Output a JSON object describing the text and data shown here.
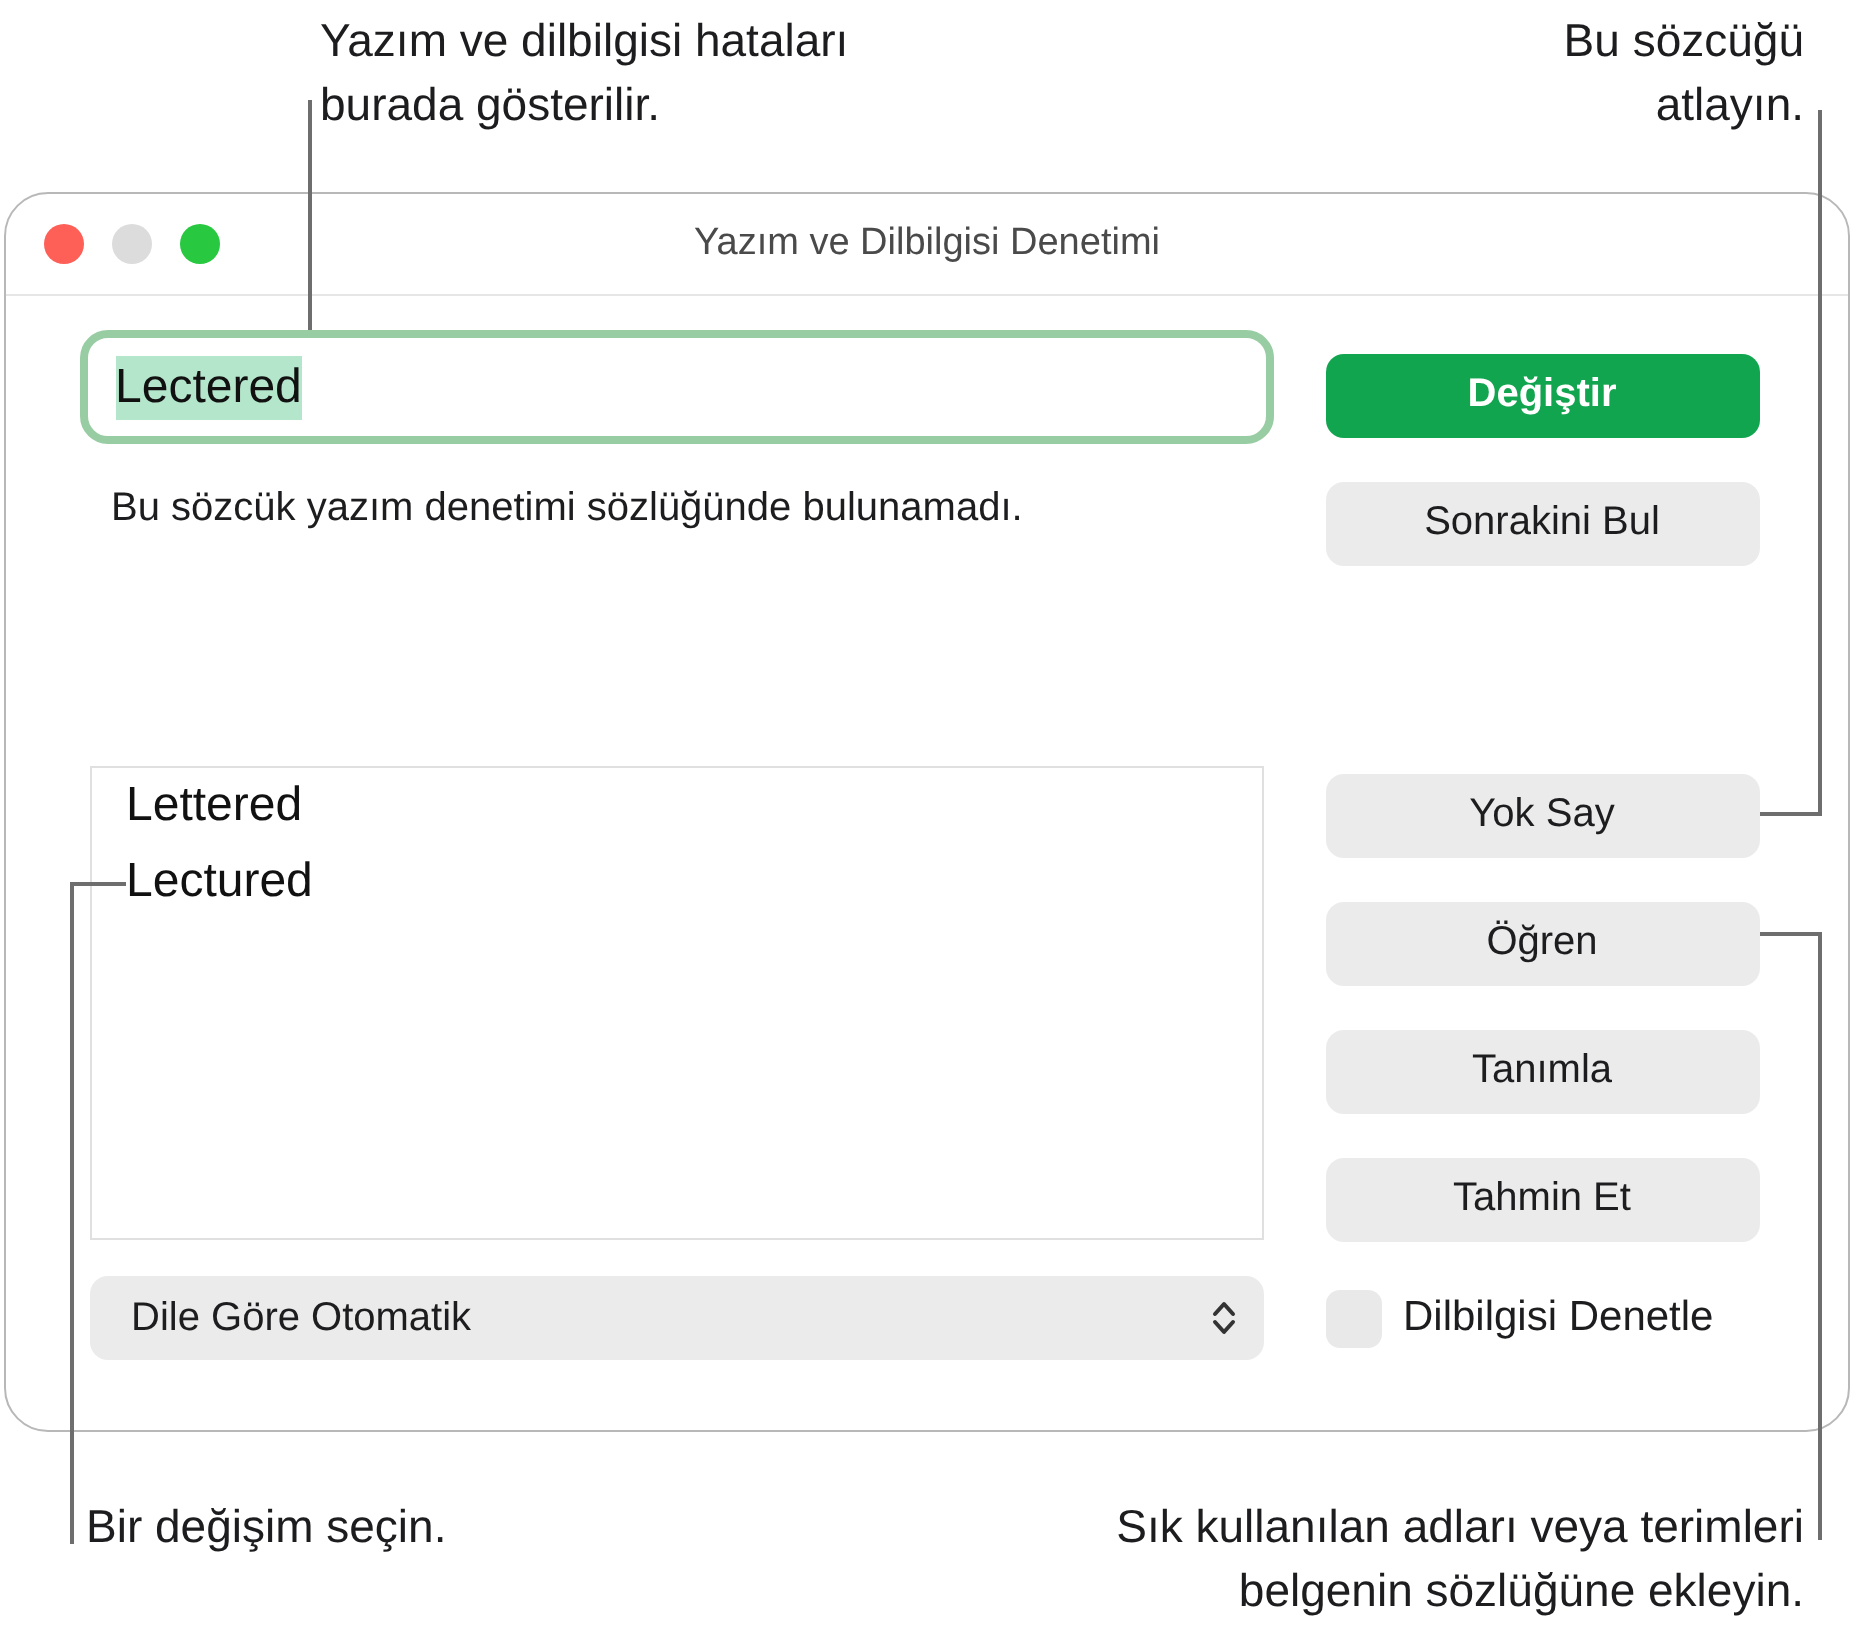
{
  "top_callouts": [
    {
      "lines": [
        "Yazım ve dilbilgisi hataları",
        "burada gösterilir."
      ]
    },
    {
      "lines": [
        "Bu sözcüğü",
        "atlayın."
      ]
    }
  ],
  "window": {
    "title": "Yazım ve Dilbilgisi Denetimi",
    "controls": [
      {
        "kind": "close",
        "disabled": false
      },
      {
        "kind": "minimize",
        "disabled": true
      },
      {
        "kind": "zoom",
        "disabled": false
      }
    ]
  },
  "misspelled_word": {
    "value": "Lectered",
    "focused": true,
    "selected": true
  },
  "message": "Bu sözcük yazım denetimi sözlüğünde bulunamadı.",
  "suggestions": [
    {
      "text": "Lettered",
      "selected": false
    },
    {
      "text": "Lectured",
      "selected": false
    }
  ],
  "language_popup": {
    "value": "Dile Göre Otomatik"
  },
  "button_groups": [
    {
      "buttons": [
        {
          "label": "Değiştir",
          "default": true
        },
        {
          "label": "Sonrakini Bul",
          "default": false
        }
      ]
    },
    {
      "buttons": [
        {
          "label": "Yok Say",
          "default": false
        },
        {
          "label": "Öğren",
          "default": false
        },
        {
          "label": "Tanımla",
          "default": false
        },
        {
          "label": "Tahmin Et",
          "default": false
        }
      ]
    }
  ],
  "grammar_checkbox": {
    "label": "Dilbilgisi Denetle",
    "checked": false
  },
  "bottom_callouts": [
    {
      "lines": [
        "Bir değişim seçin."
      ]
    },
    {
      "lines": [
        "Sık kullanılan adları veya terimleri",
        "belgenin sözlüğüne ekleyin."
      ]
    }
  ]
}
